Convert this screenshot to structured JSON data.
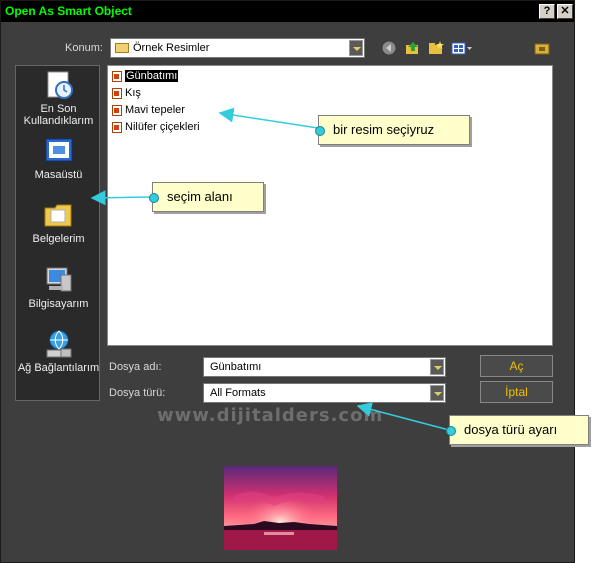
{
  "window": {
    "title": "Open As Smart Object",
    "help": "?",
    "close": "✕"
  },
  "location": {
    "label": "Konum:",
    "value": "Örnek Resimler"
  },
  "places": [
    {
      "label": "En Son Kullandıklarım"
    },
    {
      "label": "Masaüstü"
    },
    {
      "label": "Belgelerim"
    },
    {
      "label": "Bilgisayarım"
    },
    {
      "label": "Ağ Bağlantılarım"
    }
  ],
  "files": [
    {
      "name": "Günbatımı",
      "selected": true
    },
    {
      "name": "Kış",
      "selected": false
    },
    {
      "name": "Mavi tepeler",
      "selected": false
    },
    {
      "name": "Nilüfer çiçekleri",
      "selected": false
    }
  ],
  "filename": {
    "label": "Dosya adı:",
    "value": "Günbatımı"
  },
  "filetype": {
    "label": "Dosya türü:",
    "value": "All Formats"
  },
  "buttons": {
    "open": "Aç",
    "cancel": "İptal"
  },
  "watermark": "www.dijitalders.com",
  "annotations": {
    "select_image": "bir resim seçiyruz",
    "selection_area": "seçim alanı",
    "filetype_setting": "dosya türü ayarı"
  },
  "colors": {
    "title_text": "#00ff00",
    "button_text": "#f0c000",
    "callout_bg": "#ffffcc",
    "arrow": "#33ccdd"
  }
}
